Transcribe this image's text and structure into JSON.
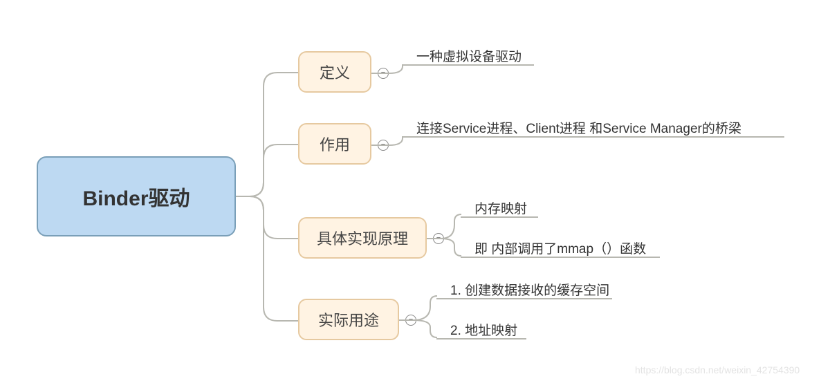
{
  "root": {
    "label": "Binder驱动",
    "fill": "#BDD9F2",
    "stroke": "#7A9FB8"
  },
  "branches": [
    {
      "id": "definition",
      "label": "定义",
      "fill": "#FFF3E3",
      "stroke": "#E6C9A0",
      "leaves": [
        "一种虚拟设备驱动"
      ]
    },
    {
      "id": "role",
      "label": "作用",
      "fill": "#FFF3E3",
      "stroke": "#E6C9A0",
      "leaves": [
        "连接Service进程、Client进程 和Service Manager的桥梁"
      ]
    },
    {
      "id": "principle",
      "label": "具体实现原理",
      "fill": "#FFF3E3",
      "stroke": "#E6C9A0",
      "leaves": [
        "内存映射",
        "即 内部调用了mmap（）函数"
      ]
    },
    {
      "id": "usage",
      "label": "实际用途",
      "fill": "#FFF3E3",
      "stroke": "#E6C9A0",
      "leaves": [
        "1. 创建数据接收的缓存空间",
        "2. 地址映射"
      ]
    }
  ],
  "watermark": "https://blog.csdn.net/weixin_42754390"
}
